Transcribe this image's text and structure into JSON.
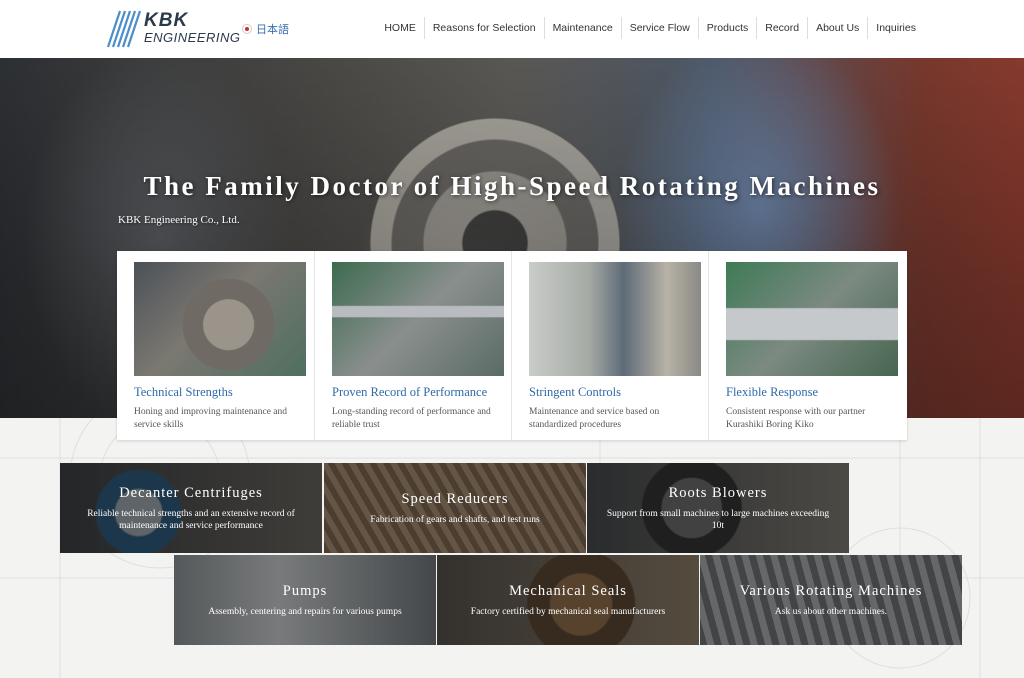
{
  "header": {
    "logo_top": "KBK",
    "logo_bottom": "ENGINEERING",
    "language": "日本語",
    "nav": [
      "HOME",
      "Reasons for Selection",
      "Maintenance",
      "Service Flow",
      "Products",
      "Record",
      "About Us",
      "Inquiries"
    ]
  },
  "hero": {
    "title": "The Family Doctor of High-Speed Rotating Machines",
    "subtitle": "KBK Engineering Co., Ltd."
  },
  "features": [
    {
      "title": "Technical Strengths",
      "desc": "Honing and improving maintenance and service skills"
    },
    {
      "title": "Proven Record of Performance",
      "desc": "Long-standing record of performance and reliable trust"
    },
    {
      "title": "Stringent Controls",
      "desc": "Maintenance and service based on standardized procedures"
    },
    {
      "title": "Flexible Response",
      "desc": "Consistent response with our partner Kurashiki Boring Kiko"
    }
  ],
  "services": [
    {
      "title": "Decanter Centrifuges",
      "desc": "Reliable technical strengths and an extensive record of maintenance and service performance"
    },
    {
      "title": "Speed Reducers",
      "desc": "Fabrication of gears and shafts, and test runs"
    },
    {
      "title": "Roots Blowers",
      "desc": "Support from small machines to large machines exceeding 10t"
    },
    {
      "title": "Pumps",
      "desc": "Assembly, centering and repairs for various pumps"
    },
    {
      "title": "Mechanical Seals",
      "desc": "Factory certified by mechanical seal manufacturers"
    },
    {
      "title": "Various Rotating Machines",
      "desc": "Ask us about other machines."
    }
  ],
  "colors": {
    "accent": "#2f6aa8",
    "logo": "#2b3a4a",
    "page_bg": "#f3f3f1"
  }
}
